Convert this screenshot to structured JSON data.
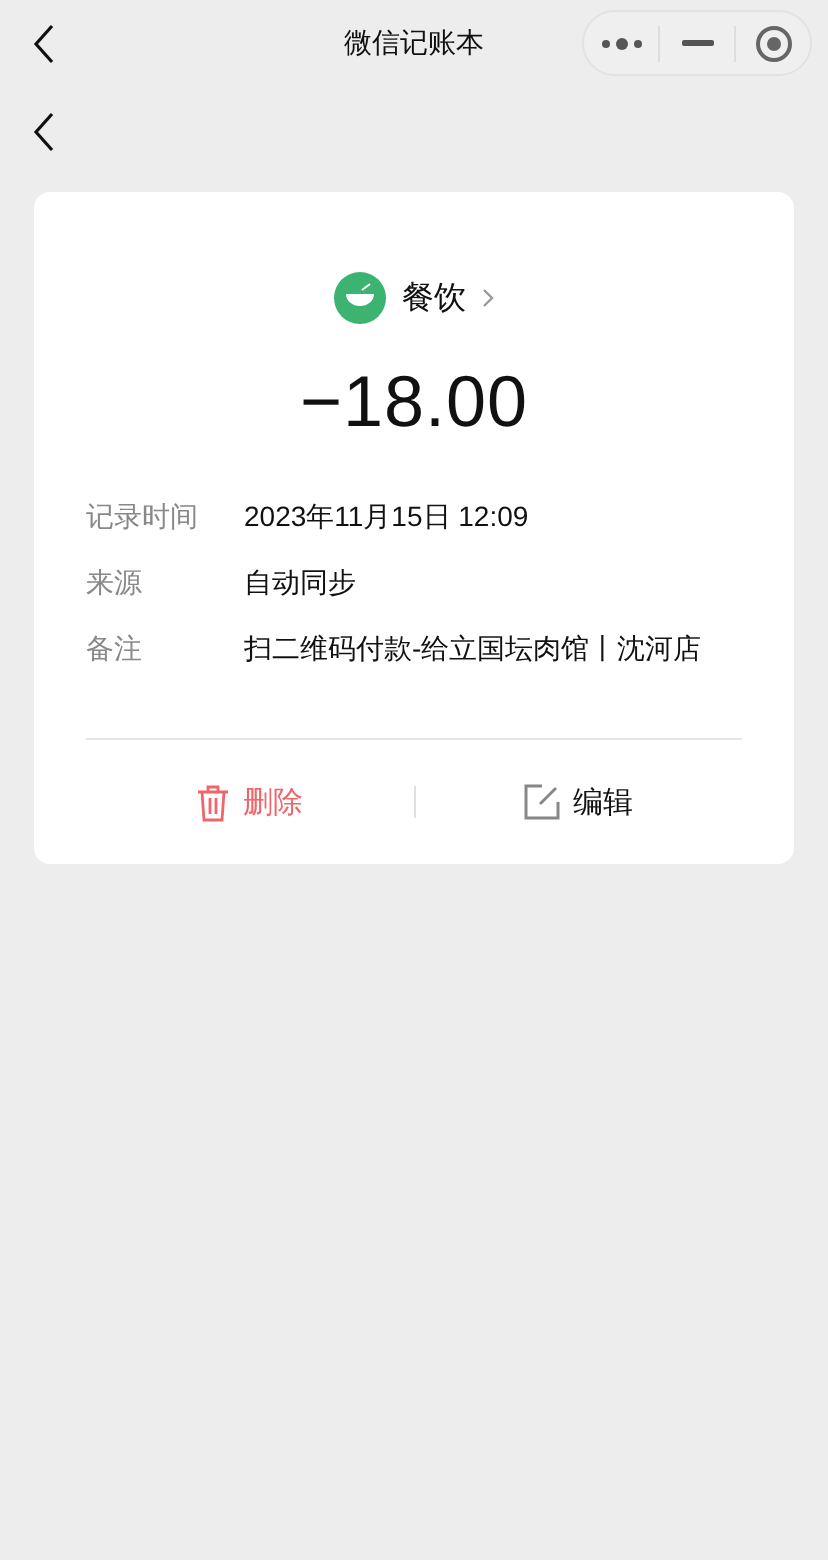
{
  "nav_bar": {
    "title": "微信记账本"
  },
  "category": {
    "label": "餐饮"
  },
  "amount": "−18.00",
  "details": [
    {
      "label": "记录时间",
      "value": "2023年11月15日 12:09"
    },
    {
      "label": "来源",
      "value": "自动同步"
    },
    {
      "label": "备注",
      "value": "扫二维码付款-给立国坛肉馆丨沈河店"
    }
  ],
  "actions": [
    {
      "kind": "delete",
      "label": "删除"
    },
    {
      "kind": "edit",
      "label": "编辑"
    }
  ]
}
